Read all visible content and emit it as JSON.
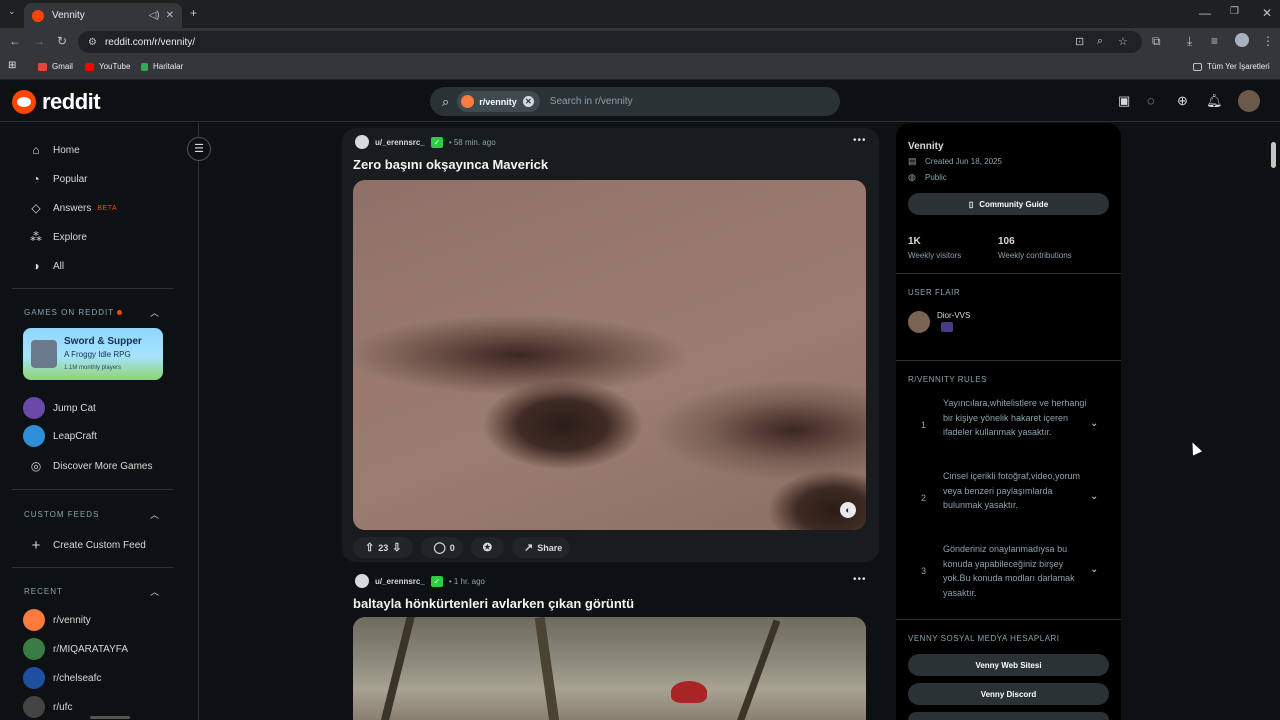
{
  "browser": {
    "tab_title": "Vennity",
    "url": "reddit.com/r/vennity/",
    "bookmarks": [
      "Gmail",
      "YouTube",
      "Haritalar"
    ],
    "all_bookmarks": "Tüm Yer İşaretleri"
  },
  "header": {
    "logo_text": "reddit",
    "search_chip": "r/vennity",
    "search_placeholder": "Search in r/vennity"
  },
  "sidebar": {
    "nav": [
      {
        "label": "Home",
        "icon": "home-icon"
      },
      {
        "label": "Popular",
        "icon": "popular-icon"
      },
      {
        "label": "Answers",
        "icon": "answers-icon",
        "badge": "BETA"
      },
      {
        "label": "Explore",
        "icon": "explore-icon"
      },
      {
        "label": "All",
        "icon": "all-icon"
      }
    ],
    "games_title": "GAMES ON REDDIT",
    "game_card": {
      "title": "Sword & Supper",
      "subtitle": "A Froggy Idle RPG",
      "players": "1.1M monthly players"
    },
    "games": [
      "Jump Cat",
      "LeapCraft",
      "Discover More Games"
    ],
    "custom_feeds_title": "CUSTOM FEEDS",
    "create_custom_feed": "Create Custom Feed",
    "recent_title": "RECENT",
    "recent": [
      {
        "label": "r/vennity",
        "color": "#ff7a3d"
      },
      {
        "label": "r/MIQARATAYFA",
        "color": "#3a7d44"
      },
      {
        "label": "r/chelseafc",
        "color": "#1f4fa0"
      },
      {
        "label": "r/ufc",
        "color": "#444444"
      }
    ]
  },
  "posts": [
    {
      "user": "u/_erennsrc_",
      "time": "• 58 min. ago",
      "title": "Zero başını okşayınca Maverick",
      "votes": "23",
      "comments": "0",
      "share": "Share"
    },
    {
      "user": "u/_erennsrc_",
      "time": "• 1 hr. ago",
      "title": "baltayla hönkürtenleri avlarken çıkan görüntü"
    }
  ],
  "community": {
    "name": "Vennity",
    "created": "Created Jun 18, 2025",
    "visibility": "Public",
    "guide_button": "Community Guide",
    "visitors": "1K",
    "visitors_label": "Weekly visitors",
    "contributions": "106",
    "contributions_label": "Weekly contributions",
    "user_flair_title": "USER FLAIR",
    "flair_user": "Dior-VVS",
    "rules_title": "R/VENNITY RULES",
    "rules": [
      {
        "num": "1",
        "text": "Yayıncılara,whitelistlere ve herhangi bir kişiye yönelik hakaret içeren ifadeler kullanmak yasaktır."
      },
      {
        "num": "2",
        "text": "Cinsel içerikli fotoğraf,video,yorum veya benzeri paylaşımlarda bulunmak yasaktır."
      },
      {
        "num": "3",
        "text": "Gönderiniz onaylanmadıysa bu konuda yapabileceğiniz birşey yok.Bu konuda modları darlamak yasaktır."
      }
    ],
    "social_title": "VENNY SOSYAL MEDYA HESAPLARI",
    "social_buttons": [
      "Venny Web Sitesi",
      "Venny Discord"
    ]
  }
}
